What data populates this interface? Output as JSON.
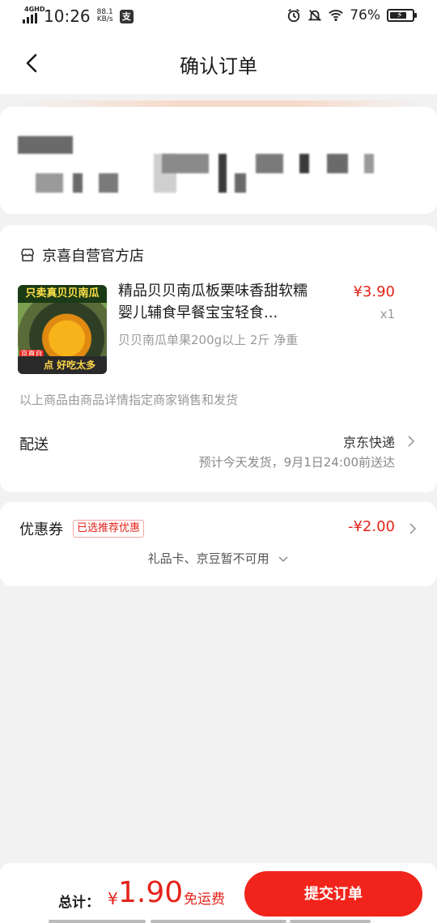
{
  "status_bar": {
    "network": "4GHD",
    "time": "10:26",
    "speed_value": "88.1",
    "speed_unit": "KB/s",
    "app_icon_char": "支",
    "battery_text": "76%",
    "battery_level": 0.76,
    "icons": [
      "alarm-icon",
      "mute-bell-icon",
      "wifi-icon",
      "battery-icon"
    ]
  },
  "header": {
    "title": "确认订单",
    "back_icon": "chevron-left-icon"
  },
  "shop": {
    "icon": "store-icon",
    "name": "京喜自营官方店",
    "product": {
      "thumb_top_text": "只卖真贝贝南瓜",
      "thumb_badge": "京喜自营 包邮",
      "thumb_bottom_text": "点 好吃太多",
      "title": "精品贝贝南瓜板栗味香甜软糯婴儿辅食早餐宝宝轻食...",
      "price": "¥3.90",
      "quantity": "x1",
      "spec": "贝贝南瓜单果200g以上 2斤 净重"
    },
    "note": "以上商品由商品详情指定商家销售和发货",
    "shipping": {
      "label": "配送",
      "carrier": "京东快递",
      "estimate": "预计今天发货，9月1日24:00前送达"
    }
  },
  "coupon": {
    "label": "优惠券",
    "tag": "已选推荐优惠",
    "value": "-¥2.00",
    "gift_text": "礼品卡、京豆暂不可用"
  },
  "footer": {
    "total_label": "总计：",
    "currency": "¥",
    "total_amount": "1.90",
    "free_shipping": "免运费",
    "submit_label": "提交订单"
  },
  "colors": {
    "accent": "#e4231a",
    "button": "#f1241b",
    "background": "#f2f2f2"
  }
}
